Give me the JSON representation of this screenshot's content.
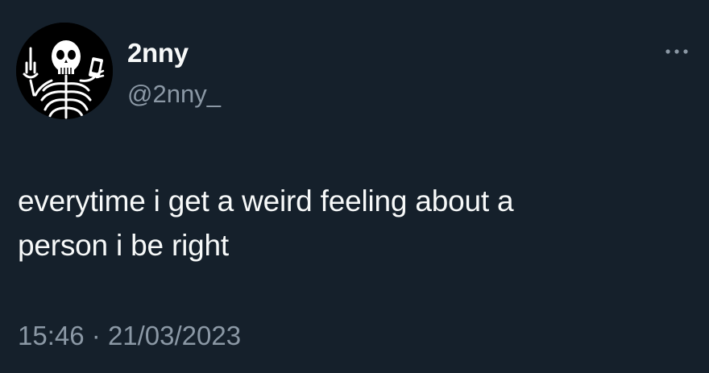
{
  "tweet": {
    "author": {
      "display_name": "2nny",
      "handle": "@2nny_",
      "avatar_icon": "skeleton-avatar"
    },
    "more_icon": "more-horizontal-icon",
    "text": "everytime i get a weird feeling about a\nperson i be right",
    "time": "15:46",
    "separator": "·",
    "date": "21/03/2023"
  },
  "colors": {
    "background": "#15202b",
    "primary_text": "#f7f9f9",
    "secondary_text": "#8b98a5"
  }
}
